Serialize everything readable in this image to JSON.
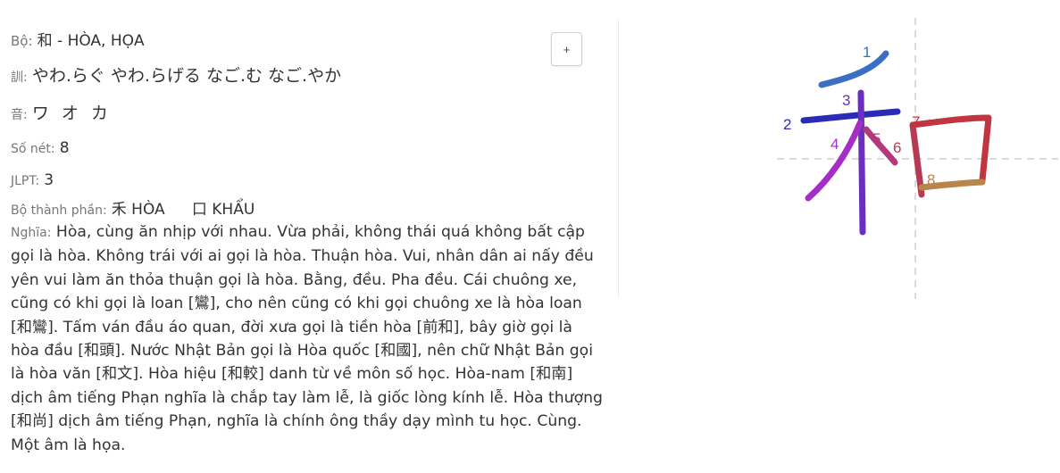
{
  "kanji": {
    "radical_label": "Bộ:",
    "radical_value": "和 - HÒA, HỌA",
    "kun_label": "訓:",
    "kun_value": "やわ.らぐ やわ.らげる なご.む なご.やか",
    "on_label": "音:",
    "on_value": "ワ オ カ",
    "strokes_label": "Số nét:",
    "strokes_value": "8",
    "jlpt_label": "JLPT:",
    "jlpt_value": "3",
    "components_label": "Bộ thành phần:",
    "components": [
      {
        "label": "禾 HÒA"
      },
      {
        "label": "口 KHẨU"
      }
    ],
    "meaning_label": "Nghĩa:",
    "meaning_value": "Hòa, cùng ăn nhịp với nhau. Vừa phải, không thái quá không bất cập gọi là hòa. Không trái với ai gọi là hòa. Thuận hòa. Vui, nhân dân ai nấy đều yên vui làm ăn thỏa thuận gọi là hòa. Bằng, đều. Pha đều. Cái chuông xe, cũng có khi gọi là loan [鸞], cho nên cũng có khi gọi chuông xe là hòa loan [和鸞]. Tấm ván đầu áo quan, đời xưa gọi là tiền hòa [前和], bây giờ gọi là hòa đầu [和頭]. Nước Nhật Bản gọi là Hòa quốc [和國], nên chữ Nhật Bản gọi là hòa văn [和文]. Hòa hiệu [和較] danh từ về môn số học. Hòa-nam [和南] dịch âm tiếng Phạn nghĩa là chắp tay làm lễ, là giốc lòng kính lễ. Hòa thượng [和尚] dịch âm tiếng Phạn, nghĩa là chính ông thầy dạy mình tu học. Cùng. Một âm là họa."
  },
  "add_button": {
    "label": "+"
  },
  "stroke_order": {
    "numbers": [
      "1",
      "2",
      "3",
      "4",
      "5",
      "6",
      "7",
      "8"
    ],
    "colors": [
      "#3a6fc4",
      "#2b2bb5",
      "#6a2fc0",
      "#a52fc6",
      "#b33a7a",
      "#b73a55",
      "#c0353f",
      "#b8864b"
    ]
  }
}
